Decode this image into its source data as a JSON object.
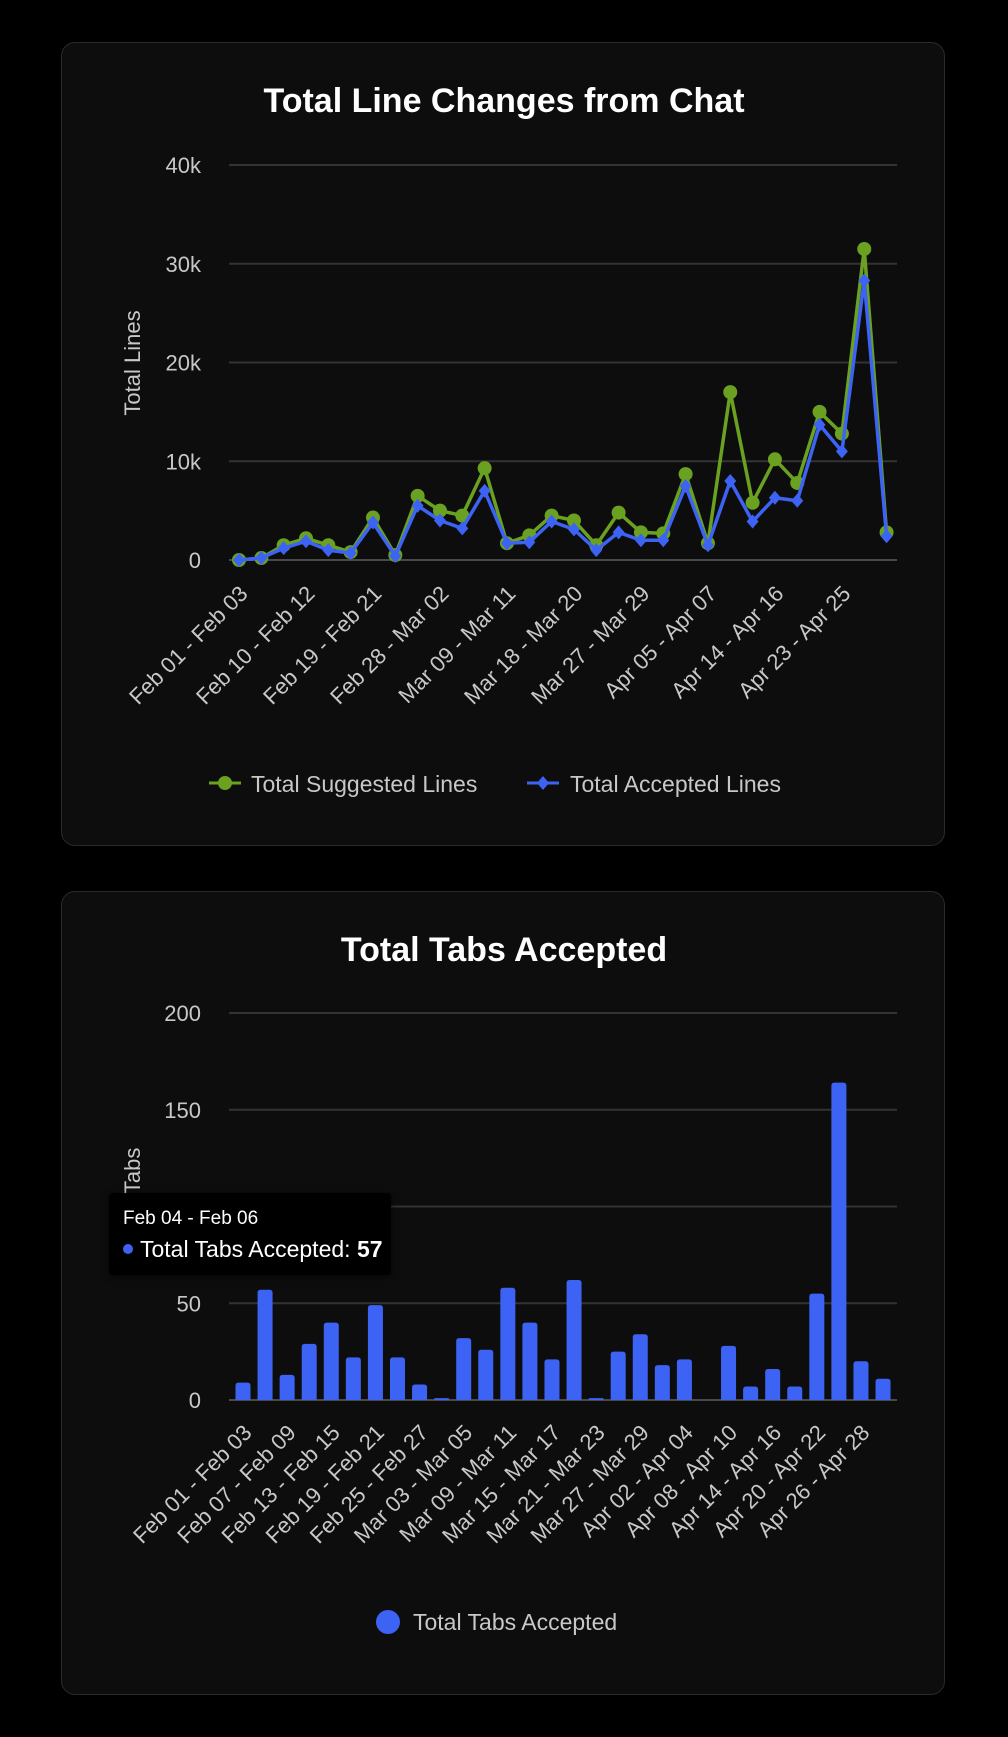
{
  "colors": {
    "suggested": "#6aa121",
    "accepted": "#3d63f4",
    "bar": "#3d63f4",
    "grid": "#333333",
    "text": "#c8c8c8",
    "title": "#ffffff"
  },
  "chart_data": [
    {
      "type": "line",
      "title": "Total Line Changes from Chat",
      "ylabel": "Total Lines",
      "xlabel": "",
      "ylim": [
        0,
        40000
      ],
      "yticks": [
        "0",
        "10k",
        "20k",
        "30k",
        "40k"
      ],
      "tick_labels": [
        "Feb 01 - Feb 03",
        "Feb 10 - Feb 12",
        "Feb 19 - Feb 21",
        "Feb 28 - Mar 02",
        "Mar 09 - Mar 11",
        "Mar 18 - Mar 20",
        "Mar 27 - Mar 29",
        "Apr 05 - Apr 07",
        "Apr 14 - Apr 16",
        "Apr 23 - Apr 25"
      ],
      "grid": true,
      "legend": "bottom",
      "series": [
        {
          "name": "Total Suggested Lines",
          "marker": "circle",
          "values": [
            0,
            200,
            1500,
            2200,
            1500,
            800,
            4300,
            500,
            6500,
            5000,
            4500,
            9300,
            1700,
            2500,
            4500,
            4000,
            1500,
            4800,
            2800,
            2700,
            8700,
            1700,
            17000,
            5800,
            10200,
            7800,
            15000,
            12800,
            31500,
            2800
          ]
        },
        {
          "name": "Total Accepted Lines",
          "marker": "diamond",
          "values": [
            0,
            200,
            1200,
            1900,
            1000,
            700,
            3800,
            400,
            5500,
            4000,
            3200,
            7000,
            1700,
            1800,
            3900,
            3100,
            1000,
            2800,
            2000,
            2000,
            7500,
            1500,
            8000,
            3900,
            6300,
            6000,
            13700,
            11000,
            28300,
            2400
          ]
        }
      ]
    },
    {
      "type": "bar",
      "title": "Total Tabs Accepted",
      "ylabel": "Total Tabs",
      "xlabel": "",
      "ylim": [
        0,
        200
      ],
      "yticks": [
        "0",
        "50",
        "100",
        "150",
        "200"
      ],
      "tick_labels": [
        "Feb 01 - Feb 03",
        "Feb 07 - Feb 09",
        "Feb 13 - Feb 15",
        "Feb 19 - Feb 21",
        "Feb 25 - Feb 27",
        "Mar 03 - Mar 05",
        "Mar 09 - Mar 11",
        "Mar 15 - Mar 17",
        "Mar 21 - Mar 23",
        "Mar 27 - Mar 29",
        "Apr 02 - Apr 04",
        "Apr 08 - Apr 10",
        "Apr 14 - Apr 16",
        "Apr 20 - Apr 22",
        "Apr 26 - Apr 28"
      ],
      "grid": true,
      "legend": "bottom",
      "series": [
        {
          "name": "Total Tabs Accepted",
          "values": [
            9,
            57,
            13,
            29,
            40,
            22,
            49,
            22,
            8,
            1,
            32,
            26,
            58,
            40,
            21,
            62,
            1,
            25,
            34,
            18,
            21,
            0,
            28,
            7,
            16,
            7,
            55,
            164,
            20,
            11
          ]
        }
      ],
      "tooltip": {
        "title": "Feb 04 - Feb 06",
        "label": "Total Tabs Accepted",
        "value": "57"
      }
    }
  ]
}
